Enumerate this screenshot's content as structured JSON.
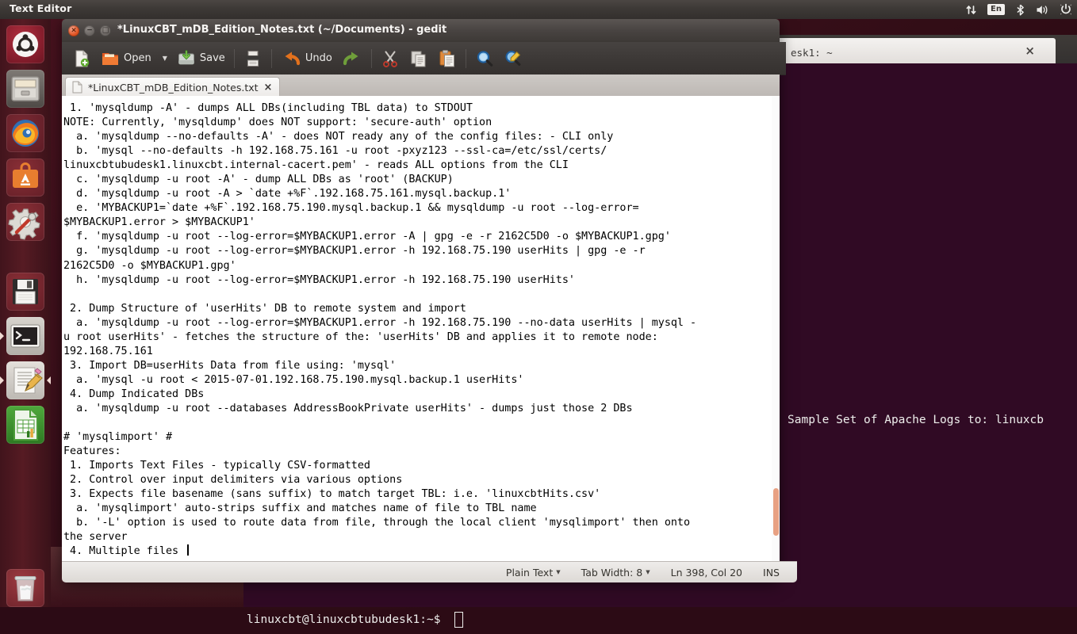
{
  "panel": {
    "title": "Text Editor",
    "tray": [
      {
        "name": "network-arrows-icon",
        "glyph": "⇅"
      },
      {
        "name": "keyboard-layout-indicator",
        "label": "En"
      },
      {
        "name": "bluetooth-icon",
        "glyph": "ᛦ"
      },
      {
        "name": "volume-icon",
        "glyph": "🔊"
      },
      {
        "name": "session-power-icon",
        "glyph": "⚙"
      }
    ]
  },
  "launcher": {
    "items": [
      {
        "name": "ubuntu-dash",
        "label": "Dash Home",
        "running": false,
        "focused": false
      },
      {
        "name": "files",
        "label": "Files",
        "running": false,
        "focused": false
      },
      {
        "name": "firefox",
        "label": "Firefox Web Browser",
        "running": false,
        "focused": false
      },
      {
        "name": "software-center",
        "label": "Ubuntu Software Center",
        "running": false,
        "focused": false
      },
      {
        "name": "system-settings",
        "label": "System Settings",
        "running": false,
        "focused": false
      },
      {
        "name": "save-disk",
        "label": "Floppy Disk",
        "running": false,
        "focused": false
      },
      {
        "name": "terminal",
        "label": "Terminal",
        "running": true,
        "focused": false
      },
      {
        "name": "gedit",
        "label": "Text Editor",
        "running": true,
        "focused": true
      },
      {
        "name": "libreoffice-calc",
        "label": "LibreOffice Calc",
        "running": false,
        "focused": false
      },
      {
        "name": "trash",
        "label": "Trash",
        "running": false,
        "focused": false
      }
    ]
  },
  "terminal": {
    "tab_label": "esk1: ~",
    "close_label": "×",
    "apache_line": "Sample Set of Apache Logs to: linuxcb",
    "prompt": "linuxcbt@linuxcbtubudesk1:~$"
  },
  "gedit": {
    "window_title": "*LinuxCBT_mDB_Edition_Notes.txt (~/Documents) - gedit",
    "window_buttons": {
      "close": "×",
      "minimize": "−",
      "maximize": "□"
    },
    "toolbar": [
      {
        "name": "new-document-button",
        "label": "",
        "icon": "new-file-icon",
        "dropdown": false
      },
      {
        "name": "open-button",
        "label": "Open",
        "icon": "open-folder-icon",
        "dropdown": true
      },
      {
        "name": "save-button",
        "label": "Save",
        "icon": "save-disk-icon",
        "dropdown": false
      },
      {
        "name": "print-button",
        "label": "",
        "icon": "printer-icon",
        "dropdown": false
      },
      {
        "name": "undo-button",
        "label": "Undo",
        "icon": "undo-arrow-icon",
        "dropdown": false
      },
      {
        "name": "redo-button",
        "label": "",
        "icon": "redo-arrow-icon",
        "dropdown": false
      },
      {
        "name": "cut-button",
        "label": "",
        "icon": "scissors-icon",
        "dropdown": false
      },
      {
        "name": "copy-button",
        "label": "",
        "icon": "copy-icon",
        "dropdown": false
      },
      {
        "name": "paste-button",
        "label": "",
        "icon": "clipboard-paste-icon",
        "dropdown": false
      },
      {
        "name": "find-button",
        "label": "",
        "icon": "magnifier-icon",
        "dropdown": false
      },
      {
        "name": "replace-button",
        "label": "",
        "icon": "find-replace-icon",
        "dropdown": false
      }
    ],
    "tab": {
      "label": "*LinuxCBT_mDB_Edition_Notes.txt",
      "close": "×"
    },
    "status": {
      "language": "Plain Text",
      "tab_width": "Tab Width: 8",
      "cursor_position": "Ln 398, Col 20",
      "insert_mode": "INS"
    },
    "document_text": " 1. 'mysqldump -A' - dumps ALL DBs(including TBL data) to STDOUT\nNOTE: Currently, 'mysqldump' does NOT support: 'secure-auth' option\n  a. 'mysqldump --no-defaults -A' - does NOT ready any of the config files: - CLI only\n  b. 'mysql --no-defaults -h 192.168.75.161 -u root -pxyz123 --ssl-ca=/etc/ssl/certs/\nlinuxcbtubudesk1.linuxcbt.internal-cacert.pem' - reads ALL options from the CLI\n  c. 'mysqldump -u root -A' - dump ALL DBs as 'root' (BACKUP)\n  d. 'mysqldump -u root -A > `date +%F`.192.168.75.161.mysql.backup.1'\n  e. 'MYBACKUP1=`date +%F`.192.168.75.190.mysql.backup.1 && mysqldump -u root --log-error=\n$MYBACKUP1.error > $MYBACKUP1'\n  f. 'mysqldump -u root --log-error=$MYBACKUP1.error -A | gpg -e -r 2162C5D0 -o $MYBACKUP1.gpg'\n  g. 'mysqldump -u root --log-error=$MYBACKUP1.error -h 192.168.75.190 userHits | gpg -e -r\n2162C5D0 -o $MYBACKUP1.gpg'\n  h. 'mysqldump -u root --log-error=$MYBACKUP1.error -h 192.168.75.190 userHits'\n\n 2. Dump Structure of 'userHits' DB to remote system and import\n  a. 'mysqldump -u root --log-error=$MYBACKUP1.error -h 192.168.75.190 --no-data userHits | mysql -\nu root userHits' - fetches the structure of the: 'userHits' DB and applies it to remote node:\n192.168.75.161\n 3. Import DB=userHits Data from file using: 'mysql'\n  a. 'mysql -u root < 2015-07-01.192.168.75.190.mysql.backup.1 userHits'\n 4. Dump Indicated DBs\n  a. 'mysqldump -u root --databases AddressBookPrivate userHits' - dumps just those 2 DBs\n\n# 'mysqlimport' #\nFeatures:\n 1. Imports Text Files - typically CSV-formatted\n 2. Control over input delimiters via various options\n 3. Expects file basename (sans suffix) to match target TBL: i.e. 'linuxcbtHits.csv'\n  a. 'mysqlimport' auto-strips suffix and matches name of file to TBL name\n  b. '-L' option is used to route data from file, through the local client 'mysqlimport' then onto\nthe server\n 4. Multiple files "
  },
  "colors": {
    "accent_orange": "#df5322",
    "launcher_bg": "#581c24",
    "terminal_bg": "#300a24",
    "panel_bg": "#3d3936",
    "scrollbar_thumb": "#e8a183"
  }
}
